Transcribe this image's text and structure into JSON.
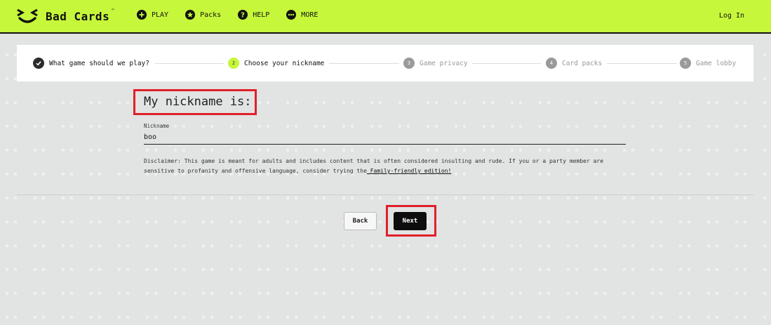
{
  "header": {
    "brand": "Bad Cards",
    "trademark": "™",
    "nav": [
      {
        "label": "PLAY",
        "icon": "plus-circle-icon"
      },
      {
        "label": "Packs",
        "icon": "star-circle-icon"
      },
      {
        "label": "HELP",
        "icon": "question-circle-icon"
      },
      {
        "label": "MORE",
        "icon": "more-dots-icon"
      }
    ],
    "login": "Log In",
    "accent": "#c6f73b"
  },
  "stepper": {
    "steps": [
      {
        "num": "✓",
        "label": "What game should we play?",
        "state": "done"
      },
      {
        "num": "2",
        "label": "Choose your nickname",
        "state": "active"
      },
      {
        "num": "3",
        "label": "Game privacy",
        "state": "pending"
      },
      {
        "num": "4",
        "label": "Card packs",
        "state": "pending"
      },
      {
        "num": "5",
        "label": "Game lobby",
        "state": "pending"
      }
    ]
  },
  "form": {
    "heading": "My nickname is:",
    "field_label": "Nickname",
    "field_value": "boo",
    "disclaimer": "Disclaimer: This game is meant for adults and includes content that is often considered insulting and rude. If you or a party member are sensitive to profanity and offensive language, consider trying the",
    "disclaimer_link": " Family-friendly edition!"
  },
  "actions": {
    "back": "Back",
    "next": "Next"
  },
  "highlight_color": "#e0202a"
}
